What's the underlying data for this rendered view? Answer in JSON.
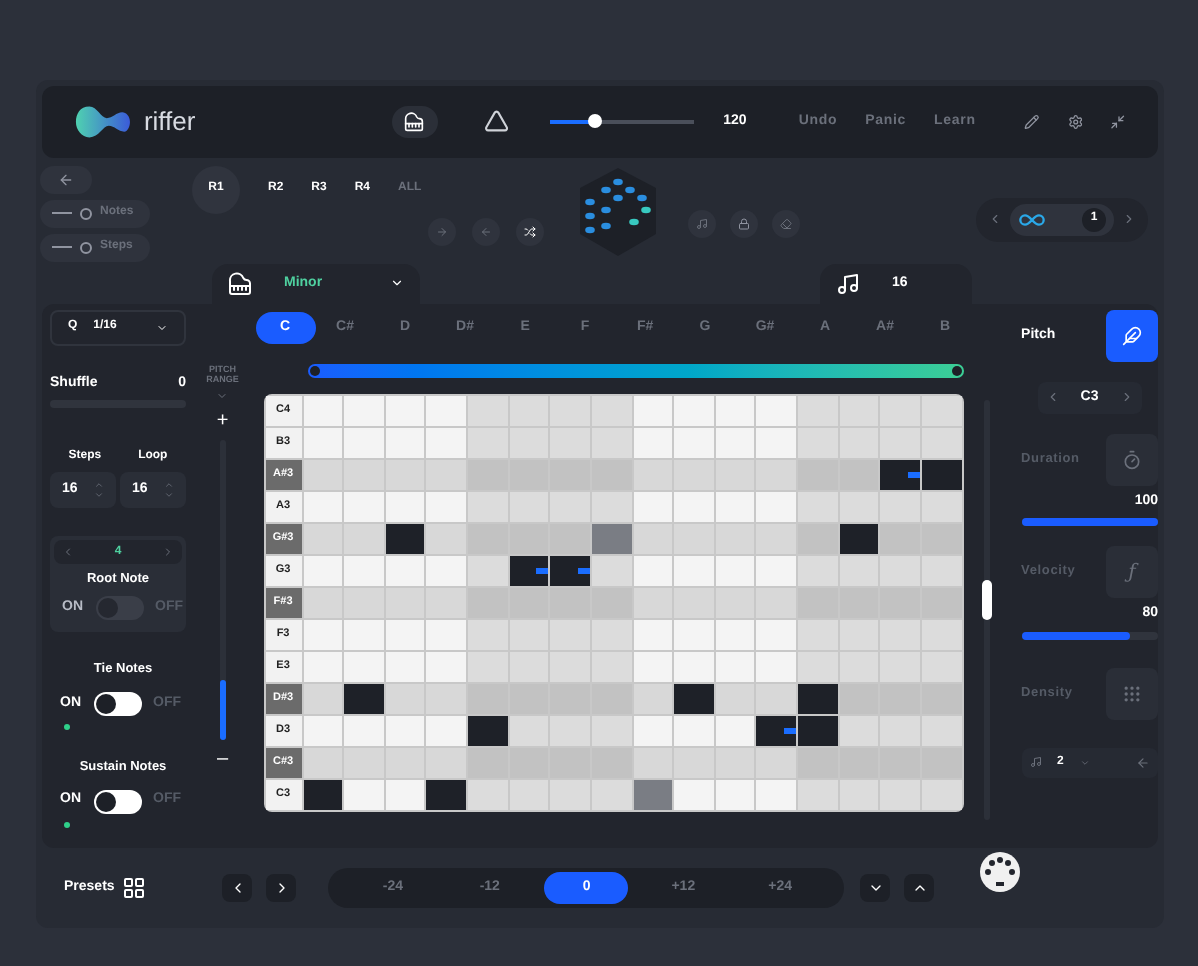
{
  "header": {
    "app_name": "riffer",
    "tempo": {
      "level": 0.3,
      "reading": "120"
    },
    "actions": [
      "Undo",
      "Panic",
      "Learn"
    ]
  },
  "left_buttons": [
    {
      "label": "Notes"
    },
    {
      "label": "Steps"
    }
  ],
  "rhythms": [
    {
      "label": "R1",
      "selected": true
    },
    {
      "label": "R2",
      "selected": false
    },
    {
      "label": "R3",
      "selected": false
    },
    {
      "label": "R4",
      "selected": false
    },
    {
      "label": "ALL",
      "selected": false
    }
  ],
  "loop": {
    "count": "1"
  },
  "scale": {
    "value": "Minor"
  },
  "note_length": {
    "value": "16"
  },
  "quantize": {
    "label": "Q",
    "value": "1/16"
  },
  "shuffle": {
    "label": "Shuffle",
    "value": "0",
    "level": 0
  },
  "steps": {
    "label": "Steps",
    "value": "16"
  },
  "loop_length": {
    "label": "Loop",
    "value": "16"
  },
  "root_note": {
    "value": "4",
    "label": "Root Note",
    "on_label": "ON",
    "off_label": "OFF",
    "on": false,
    "disabled": true
  },
  "tie_notes": {
    "label": "Tie Notes",
    "on_label": "ON",
    "off_label": "OFF",
    "on": false,
    "led": true
  },
  "sustain_notes": {
    "label": "Sustain Notes",
    "on_label": "ON",
    "off_label": "OFF",
    "on": false,
    "led": true
  },
  "pitch_range": {
    "label": "PITCH RANGE",
    "plus": "+",
    "minus": "–",
    "level": 0.2
  },
  "keys": [
    {
      "label": "C",
      "selected": true
    },
    {
      "label": "C#",
      "selected": false
    },
    {
      "label": "D",
      "selected": false
    },
    {
      "label": "D#",
      "selected": false
    },
    {
      "label": "E",
      "selected": false
    },
    {
      "label": "F",
      "selected": false
    },
    {
      "label": "F#",
      "selected": false
    },
    {
      "label": "G",
      "selected": false
    },
    {
      "label": "G#",
      "selected": false
    },
    {
      "label": "A",
      "selected": false
    },
    {
      "label": "A#",
      "selected": false
    },
    {
      "label": "B",
      "selected": false
    }
  ],
  "grid": [
    {
      "label": "C4",
      "black_key": false,
      "cells": [
        {
          "kind": "rest"
        },
        {
          "kind": "rest"
        },
        {
          "kind": "rest"
        },
        {
          "kind": "rest"
        },
        {
          "kind": "rest"
        },
        {
          "kind": "rest"
        },
        {
          "kind": "rest"
        },
        {
          "kind": "rest"
        },
        {
          "kind": "rest"
        },
        {
          "kind": "rest"
        },
        {
          "kind": "rest"
        },
        {
          "kind": "rest"
        },
        {
          "kind": "rest"
        },
        {
          "kind": "rest"
        },
        {
          "kind": "rest"
        },
        {
          "kind": "rest"
        }
      ]
    },
    {
      "label": "B3",
      "black_key": false,
      "cells": [
        {
          "kind": "rest"
        },
        {
          "kind": "rest"
        },
        {
          "kind": "rest"
        },
        {
          "kind": "rest"
        },
        {
          "kind": "rest"
        },
        {
          "kind": "rest"
        },
        {
          "kind": "rest"
        },
        {
          "kind": "rest"
        },
        {
          "kind": "rest"
        },
        {
          "kind": "rest"
        },
        {
          "kind": "rest"
        },
        {
          "kind": "rest"
        },
        {
          "kind": "rest"
        },
        {
          "kind": "rest"
        },
        {
          "kind": "rest"
        },
        {
          "kind": "rest"
        }
      ]
    },
    {
      "label": "A#3",
      "black_key": true,
      "cells": [
        {
          "kind": "rest"
        },
        {
          "kind": "rest"
        },
        {
          "kind": "rest"
        },
        {
          "kind": "rest"
        },
        {
          "kind": "rest"
        },
        {
          "kind": "rest"
        },
        {
          "kind": "rest"
        },
        {
          "kind": "rest"
        },
        {
          "kind": "rest"
        },
        {
          "kind": "rest"
        },
        {
          "kind": "rest"
        },
        {
          "kind": "rest"
        },
        {
          "kind": "rest"
        },
        {
          "kind": "rest"
        },
        {
          "kind": "tied"
        },
        {
          "kind": "note"
        }
      ]
    },
    {
      "label": "A3",
      "black_key": false,
      "cells": [
        {
          "kind": "rest"
        },
        {
          "kind": "rest"
        },
        {
          "kind": "rest"
        },
        {
          "kind": "rest"
        },
        {
          "kind": "rest"
        },
        {
          "kind": "rest"
        },
        {
          "kind": "rest"
        },
        {
          "kind": "rest"
        },
        {
          "kind": "rest"
        },
        {
          "kind": "rest"
        },
        {
          "kind": "rest"
        },
        {
          "kind": "rest"
        },
        {
          "kind": "rest"
        },
        {
          "kind": "rest"
        },
        {
          "kind": "rest"
        },
        {
          "kind": "rest"
        }
      ]
    },
    {
      "label": "G#3",
      "black_key": true,
      "cells": [
        {
          "kind": "rest"
        },
        {
          "kind": "rest"
        },
        {
          "kind": "note"
        },
        {
          "kind": "rest"
        },
        {
          "kind": "rest"
        },
        {
          "kind": "rest"
        },
        {
          "kind": "rest"
        },
        {
          "kind": "ghost"
        },
        {
          "kind": "rest"
        },
        {
          "kind": "rest"
        },
        {
          "kind": "rest"
        },
        {
          "kind": "rest"
        },
        {
          "kind": "rest"
        },
        {
          "kind": "note"
        },
        {
          "kind": "rest"
        },
        {
          "kind": "rest"
        }
      ]
    },
    {
      "label": "G3",
      "black_key": false,
      "cells": [
        {
          "kind": "rest"
        },
        {
          "kind": "rest"
        },
        {
          "kind": "rest"
        },
        {
          "kind": "rest"
        },
        {
          "kind": "rest"
        },
        {
          "kind": "tied"
        },
        {
          "kind": "tied"
        },
        {
          "kind": "rest"
        },
        {
          "kind": "rest"
        },
        {
          "kind": "rest"
        },
        {
          "kind": "rest"
        },
        {
          "kind": "rest"
        },
        {
          "kind": "rest"
        },
        {
          "kind": "rest"
        },
        {
          "kind": "rest"
        },
        {
          "kind": "rest"
        }
      ]
    },
    {
      "label": "F#3",
      "black_key": true,
      "cells": [
        {
          "kind": "rest"
        },
        {
          "kind": "rest"
        },
        {
          "kind": "rest"
        },
        {
          "kind": "rest"
        },
        {
          "kind": "rest"
        },
        {
          "kind": "rest"
        },
        {
          "kind": "rest"
        },
        {
          "kind": "rest"
        },
        {
          "kind": "rest"
        },
        {
          "kind": "rest"
        },
        {
          "kind": "rest"
        },
        {
          "kind": "rest"
        },
        {
          "kind": "rest"
        },
        {
          "kind": "rest"
        },
        {
          "kind": "rest"
        },
        {
          "kind": "rest"
        }
      ]
    },
    {
      "label": "F3",
      "black_key": false,
      "cells": [
        {
          "kind": "rest"
        },
        {
          "kind": "rest"
        },
        {
          "kind": "rest"
        },
        {
          "kind": "rest"
        },
        {
          "kind": "rest"
        },
        {
          "kind": "rest"
        },
        {
          "kind": "rest"
        },
        {
          "kind": "rest"
        },
        {
          "kind": "rest"
        },
        {
          "kind": "rest"
        },
        {
          "kind": "rest"
        },
        {
          "kind": "rest"
        },
        {
          "kind": "rest"
        },
        {
          "kind": "rest"
        },
        {
          "kind": "rest"
        },
        {
          "kind": "rest"
        }
      ]
    },
    {
      "label": "E3",
      "black_key": false,
      "cells": [
        {
          "kind": "rest"
        },
        {
          "kind": "rest"
        },
        {
          "kind": "rest"
        },
        {
          "kind": "rest"
        },
        {
          "kind": "rest"
        },
        {
          "kind": "rest"
        },
        {
          "kind": "rest"
        },
        {
          "kind": "rest"
        },
        {
          "kind": "rest"
        },
        {
          "kind": "rest"
        },
        {
          "kind": "rest"
        },
        {
          "kind": "rest"
        },
        {
          "kind": "rest"
        },
        {
          "kind": "rest"
        },
        {
          "kind": "rest"
        },
        {
          "kind": "rest"
        }
      ]
    },
    {
      "label": "D#3",
      "black_key": true,
      "cells": [
        {
          "kind": "rest"
        },
        {
          "kind": "note"
        },
        {
          "kind": "rest"
        },
        {
          "kind": "rest"
        },
        {
          "kind": "rest"
        },
        {
          "kind": "rest"
        },
        {
          "kind": "rest"
        },
        {
          "kind": "rest"
        },
        {
          "kind": "rest"
        },
        {
          "kind": "note"
        },
        {
          "kind": "rest"
        },
        {
          "kind": "rest"
        },
        {
          "kind": "note"
        },
        {
          "kind": "rest"
        },
        {
          "kind": "rest"
        },
        {
          "kind": "rest"
        }
      ]
    },
    {
      "label": "D3",
      "black_key": false,
      "cells": [
        {
          "kind": "rest"
        },
        {
          "kind": "rest"
        },
        {
          "kind": "rest"
        },
        {
          "kind": "rest"
        },
        {
          "kind": "note"
        },
        {
          "kind": "rest"
        },
        {
          "kind": "rest"
        },
        {
          "kind": "rest"
        },
        {
          "kind": "rest"
        },
        {
          "kind": "rest"
        },
        {
          "kind": "rest"
        },
        {
          "kind": "tied"
        },
        {
          "kind": "note"
        },
        {
          "kind": "rest"
        },
        {
          "kind": "rest"
        },
        {
          "kind": "rest"
        }
      ]
    },
    {
      "label": "C#3",
      "black_key": true,
      "cells": [
        {
          "kind": "rest"
        },
        {
          "kind": "rest"
        },
        {
          "kind": "rest"
        },
        {
          "kind": "rest"
        },
        {
          "kind": "rest"
        },
        {
          "kind": "rest"
        },
        {
          "kind": "rest"
        },
        {
          "kind": "rest"
        },
        {
          "kind": "rest"
        },
        {
          "kind": "rest"
        },
        {
          "kind": "rest"
        },
        {
          "kind": "rest"
        },
        {
          "kind": "rest"
        },
        {
          "kind": "rest"
        },
        {
          "kind": "rest"
        },
        {
          "kind": "rest"
        }
      ]
    },
    {
      "label": "C3",
      "black_key": false,
      "cells": [
        {
          "kind": "note"
        },
        {
          "kind": "rest"
        },
        {
          "kind": "rest"
        },
        {
          "kind": "note"
        },
        {
          "kind": "rest"
        },
        {
          "kind": "rest"
        },
        {
          "kind": "rest"
        },
        {
          "kind": "rest"
        },
        {
          "kind": "ghost"
        },
        {
          "kind": "rest"
        },
        {
          "kind": "rest"
        },
        {
          "kind": "rest"
        },
        {
          "kind": "rest"
        },
        {
          "kind": "rest"
        },
        {
          "kind": "rest"
        },
        {
          "kind": "rest"
        }
      ]
    }
  ],
  "right_panel": {
    "mode": {
      "label": "Pitch",
      "active": true
    },
    "note": "C3",
    "duration": {
      "label": "Duration",
      "value": "100",
      "level": 1
    },
    "velocity": {
      "label": "Velocity",
      "value": "80",
      "level": 0.8,
      "icon_text": "ƒ"
    },
    "density": {
      "label": "Density"
    },
    "stepper": "2"
  },
  "footer": {
    "presets": "Presets",
    "octaves": [
      {
        "label": "-24",
        "selected": false
      },
      {
        "label": "-12",
        "selected": false
      },
      {
        "label": "0",
        "selected": true
      },
      {
        "label": "+12",
        "selected": false
      },
      {
        "label": "+24",
        "selected": false
      }
    ]
  }
}
